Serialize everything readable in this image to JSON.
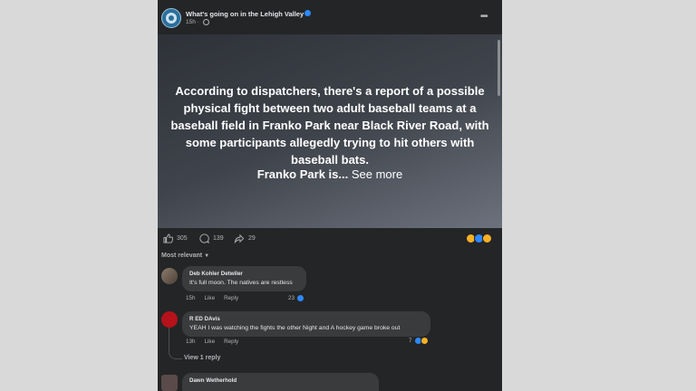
{
  "post": {
    "page_name": "What's going on in the Lehigh Valley",
    "time": "15h",
    "body": "According to dispatchers, there's a report of a possible physical fight between two adult baseball teams at a baseball field in Franko Park near Black River Road, with some participants allegedly trying to hit others with baseball bats.",
    "body_tail": "Franko Park is...",
    "see_more": "See more"
  },
  "stats": {
    "likes": "305",
    "comments": "139",
    "shares": "29"
  },
  "sort_label": "Most relevant",
  "comments": [
    {
      "author": "Deb Kohler Detwiler",
      "text": "It's full moon. The natives are restless",
      "time": "15h",
      "like_label": "Like",
      "reply_label": "Reply",
      "reaction_count": "23"
    },
    {
      "author": "R ED DAvis",
      "text": "YEAH I was watching the fights the other Night and A hockey game broke out",
      "time": "13h",
      "like_label": "Like",
      "reply_label": "Reply",
      "reaction_count": "7",
      "view_replies": "View 1 reply"
    },
    {
      "author": "Dawn Wetherhold"
    }
  ],
  "colors": {
    "panel_bg": "#242526",
    "bubble_bg": "#3a3b3c",
    "like_blue": "#2d88ff",
    "haha_yellow": "#f7b125",
    "avatar_red": "#b5121b"
  }
}
